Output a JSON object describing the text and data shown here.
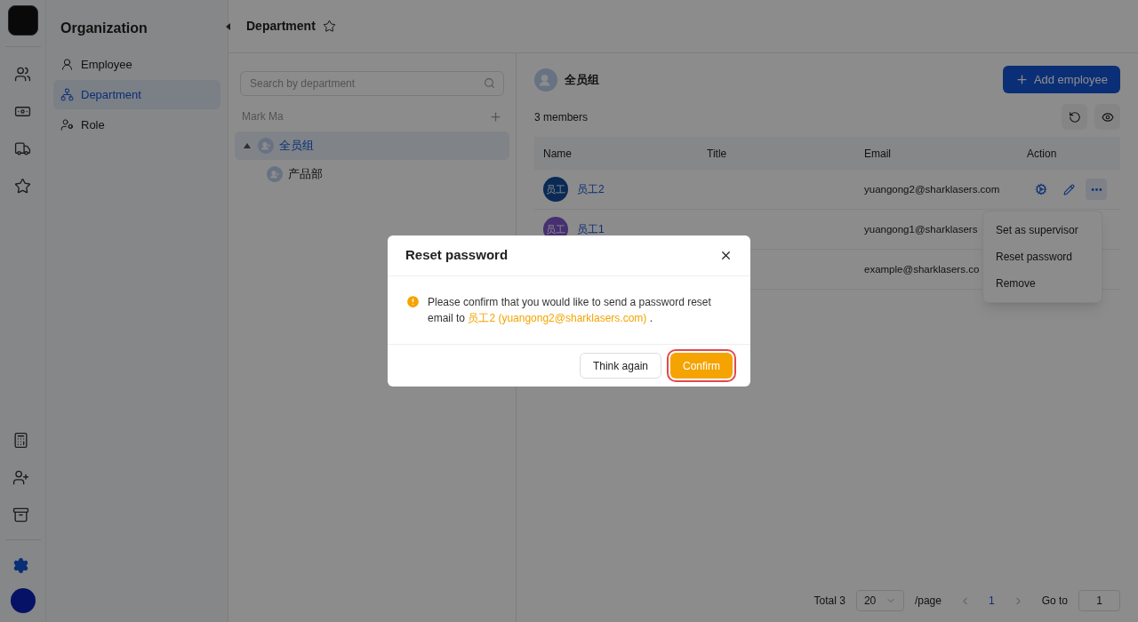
{
  "rail": {
    "top": [
      {
        "kind": "users",
        "selected": false
      },
      {
        "kind": "billing",
        "selected": false
      },
      {
        "kind": "truck",
        "selected": false
      },
      {
        "kind": "star",
        "selected": false
      }
    ],
    "bottom": [
      {
        "kind": "calculator",
        "selected": false
      },
      {
        "kind": "user-plus",
        "selected": false
      },
      {
        "kind": "archive",
        "selected": false
      },
      {
        "kind": "settings",
        "selected": true
      }
    ]
  },
  "sidebar": {
    "title": "Organization",
    "items": [
      {
        "label": "Employee",
        "kind": "employee",
        "selected": false
      },
      {
        "label": "Department",
        "kind": "department",
        "selected": true
      },
      {
        "label": "Role",
        "kind": "role",
        "selected": false
      }
    ]
  },
  "header": {
    "title": "Department",
    "starred": false
  },
  "tree": {
    "search": {
      "placeholder": "Search by department"
    },
    "owner": "Mark Ma",
    "items": [
      {
        "label": "全员组",
        "selected": true,
        "expanded": true,
        "children": [
          {
            "label": "产品部",
            "selected": false
          }
        ]
      }
    ]
  },
  "group": {
    "name": "全员组",
    "add_button": "Add employee",
    "members": "3 members"
  },
  "table": {
    "columns": [
      "Name",
      "Title",
      "Email",
      "Action"
    ],
    "rows": [
      {
        "avatar": "员工",
        "color": "#0a2a55",
        "name": "员工2",
        "email": "yuangong2@sharklasers.com"
      },
      {
        "avatar": "员工",
        "color": "#463071",
        "name": "员工1",
        "email": "yuangong1@sharklasers"
      },
      {
        "email": "example@sharklasers.co"
      }
    ]
  },
  "menu": {
    "open": true,
    "items": [
      "Set as supervisor",
      "Reset password",
      "Remove"
    ]
  },
  "pagination": {
    "total": "Total 3",
    "page_size": "20",
    "per_page": "/page",
    "pages": [
      {
        "label": "1",
        "selected": true
      }
    ],
    "goto_label": "Go to",
    "goto_value": "1"
  },
  "dialog": {
    "title": "Reset password",
    "message_before": "Please confirm that you would like to send a password reset email to",
    "message_target": "员工2 (yuangong2@sharklasers.com)",
    "message_after": ".",
    "buttons": [
      {
        "label": "Think again",
        "kind": "secondary",
        "highlighted": false
      },
      {
        "label": "Confirm",
        "kind": "primary",
        "highlighted": true
      }
    ]
  }
}
